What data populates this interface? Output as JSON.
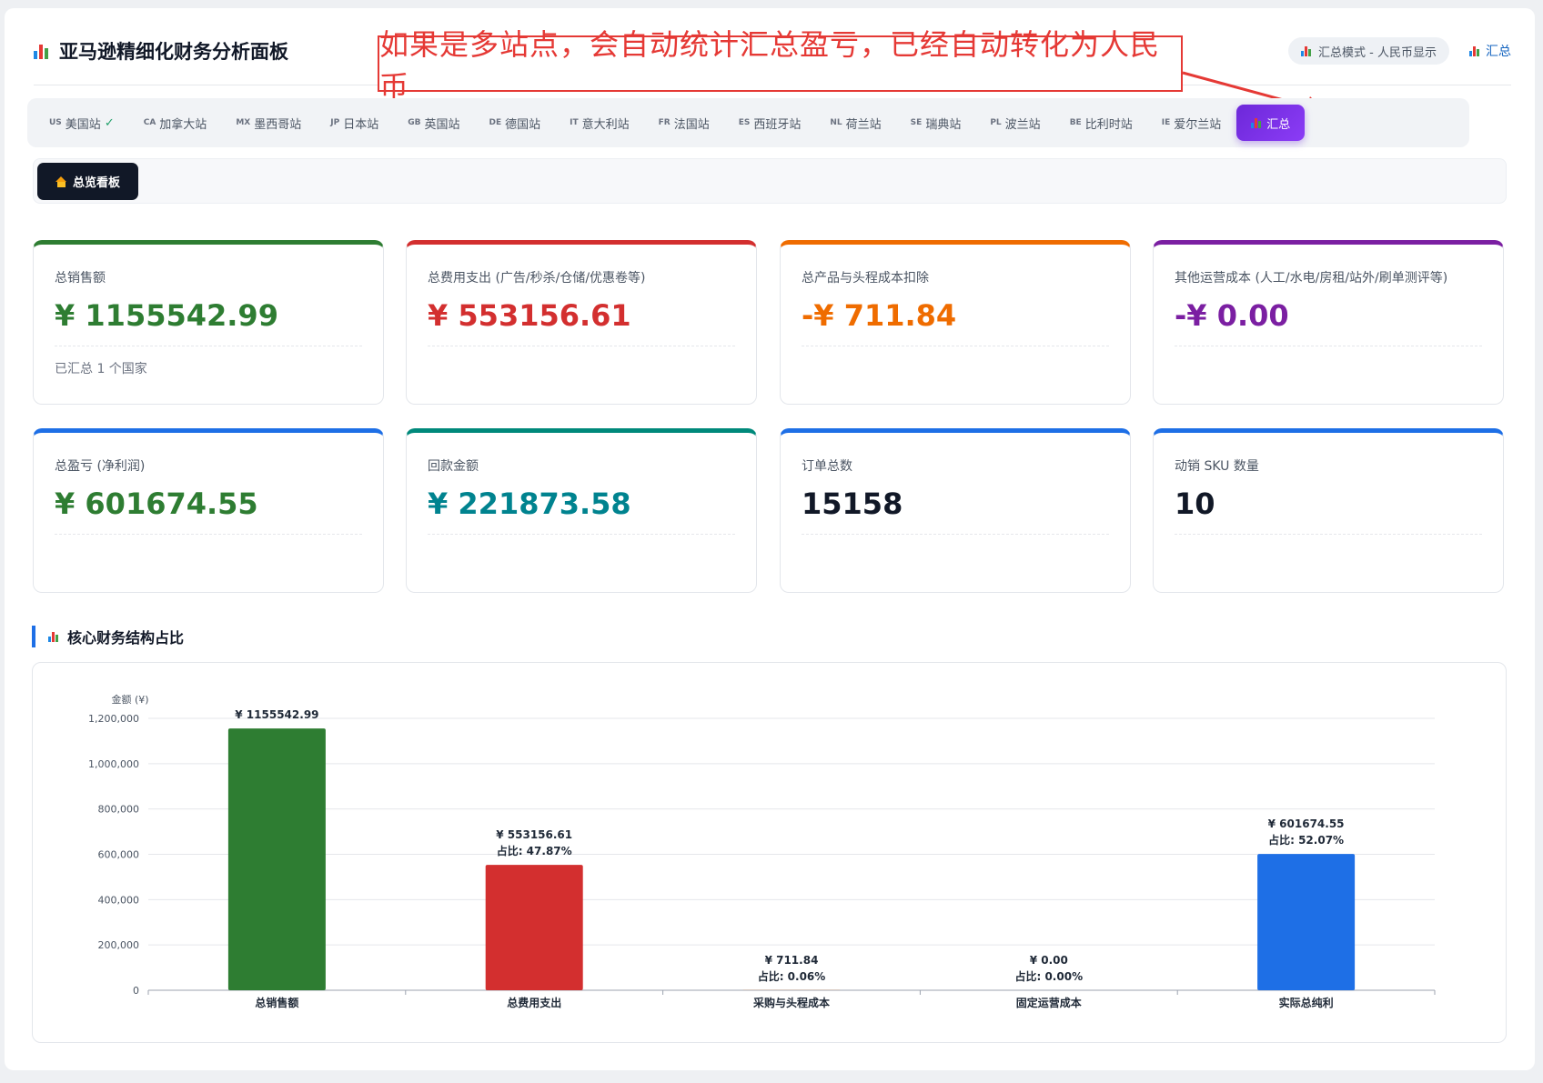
{
  "header": {
    "title": "亚马逊精细化财务分析面板",
    "mode_label": "汇总模式 - 人民币显示",
    "summary_link": "汇总"
  },
  "annotation": {
    "text": "如果是多站点，会自动统计汇总盈亏，已经自动转化为人民币",
    "color": "#e53935"
  },
  "site_tabs": [
    {
      "code": "US",
      "label": "美国站",
      "check": "✓"
    },
    {
      "code": "CA",
      "label": "加拿大站"
    },
    {
      "code": "MX",
      "label": "墨西哥站"
    },
    {
      "code": "JP",
      "label": "日本站"
    },
    {
      "code": "GB",
      "label": "英国站"
    },
    {
      "code": "DE",
      "label": "德国站"
    },
    {
      "code": "IT",
      "label": "意大利站"
    },
    {
      "code": "FR",
      "label": "法国站"
    },
    {
      "code": "ES",
      "label": "西班牙站"
    },
    {
      "code": "NL",
      "label": "荷兰站"
    },
    {
      "code": "SE",
      "label": "瑞典站"
    },
    {
      "code": "PL",
      "label": "波兰站"
    },
    {
      "code": "BE",
      "label": "比利时站"
    },
    {
      "code": "IE",
      "label": "爱尔兰站"
    },
    {
      "code": "",
      "label": "汇总",
      "active": true
    }
  ],
  "view_button": "总览看板",
  "cards": [
    {
      "label": "总销售额",
      "value": "¥ 1155542.99",
      "note": "已汇总 1 个国家",
      "color": "#2e7d32"
    },
    {
      "label": "总费用支出 (广告/秒杀/仓储/优惠卷等)",
      "value": "¥ 553156.61",
      "note": "",
      "color": "#d32f2f"
    },
    {
      "label": "总产品与头程成本扣除",
      "value": "-¥ 711.84",
      "note": "",
      "color": "#ef6c00"
    },
    {
      "label": "其他运营成本 (人工/水电/房租/站外/刷单测评等)",
      "value": "-¥ 0.00",
      "note": "",
      "color": "#7b1fa2"
    },
    {
      "label": "总盈亏 (净利润)",
      "value": "¥ 601674.55",
      "note": "",
      "color": "#2e7d32",
      "border": "#1e6fe6"
    },
    {
      "label": "回款金额",
      "value": "¥ 221873.58",
      "note": "",
      "color": "#00838f",
      "border": "#00897b"
    },
    {
      "label": "订单总数",
      "value": "15158",
      "note": "",
      "color": "#111827",
      "border": "#1e6fe6"
    },
    {
      "label": "动销 SKU 数量",
      "value": "10",
      "note": "",
      "color": "#111827",
      "border": "#1e6fe6"
    }
  ],
  "section": {
    "title": "核心财务结构占比"
  },
  "chart_data": {
    "type": "bar",
    "ylabel": "金额 (¥)",
    "ylim": [
      0,
      1200000
    ],
    "yticks": [
      0,
      200000,
      400000,
      600000,
      800000,
      1000000,
      1200000
    ],
    "ytick_labels": [
      "0",
      "200,000",
      "400,000",
      "600,000",
      "800,000",
      "1,000,000",
      "1,200,000"
    ],
    "grid": true,
    "categories": [
      "总销售额",
      "总费用支出",
      "采购与头程成本",
      "固定运营成本",
      "实际总纯利"
    ],
    "values": [
      1155542.99,
      553156.61,
      711.84,
      0.0,
      601674.55
    ],
    "colors": [
      "#2e7d32",
      "#d32f2f",
      "#ef6c00",
      "#7b1fa2",
      "#1e6fe6"
    ],
    "value_labels": [
      "¥ 1155542.99",
      "¥ 553156.61",
      "¥ 711.84",
      "¥ 0.00",
      "¥ 601674.55"
    ],
    "share_labels": [
      "",
      "占比: 47.87%",
      "占比: 0.06%",
      "占比: 0.00%",
      "占比: 52.07%"
    ]
  }
}
